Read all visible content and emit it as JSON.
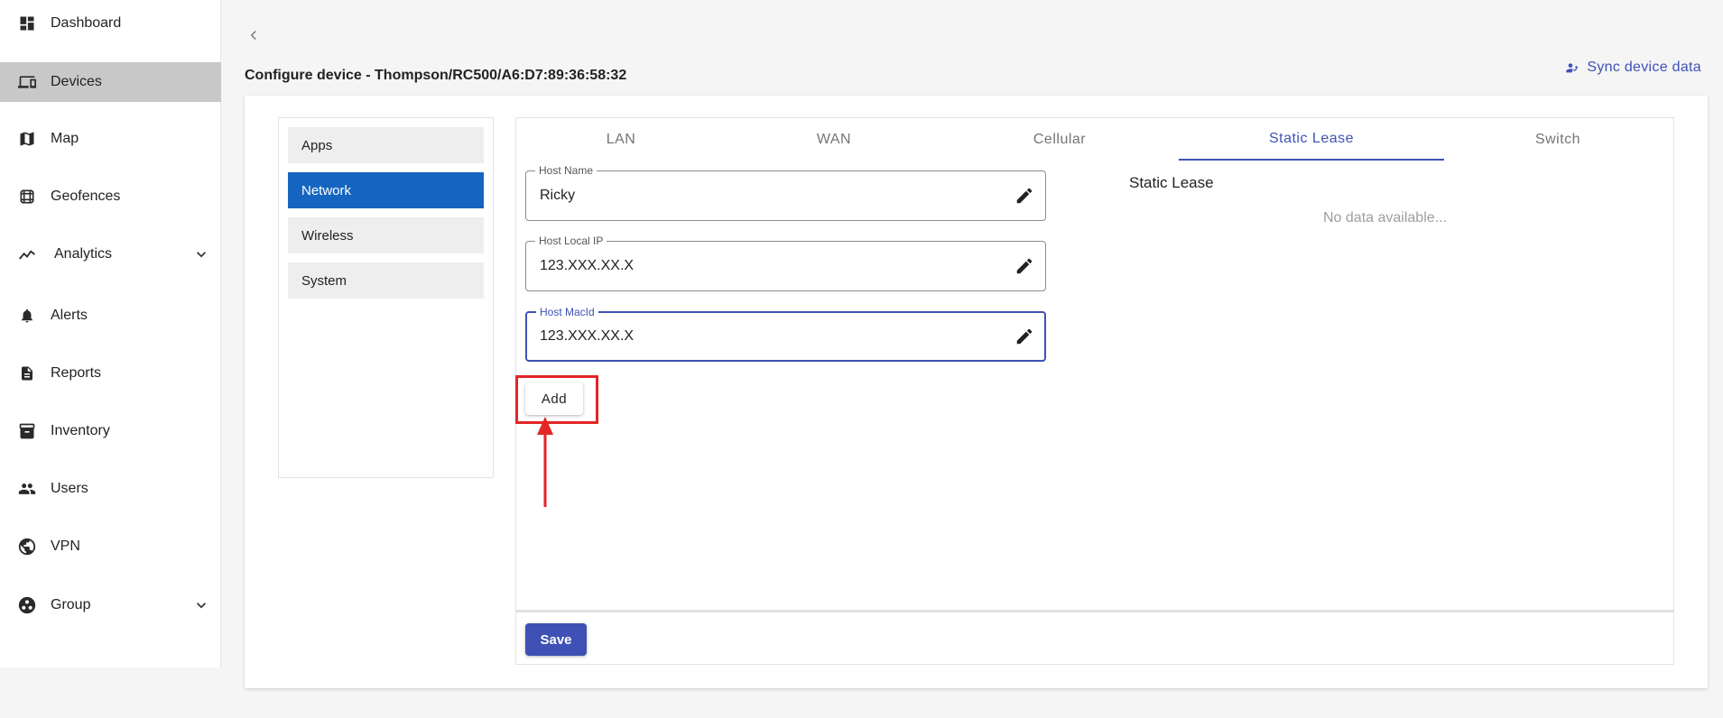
{
  "sidebar": {
    "items": [
      {
        "label": "Dashboard",
        "icon": "dashboard-icon"
      },
      {
        "label": "Devices",
        "icon": "devices-icon",
        "active": true
      },
      {
        "label": "Map",
        "icon": "map-icon"
      },
      {
        "label": "Geofences",
        "icon": "geofence-icon"
      },
      {
        "label": "Analytics",
        "icon": "analytics-icon",
        "expandable": true
      },
      {
        "label": "Alerts",
        "icon": "bell-icon"
      },
      {
        "label": "Reports",
        "icon": "report-icon"
      },
      {
        "label": "Inventory",
        "icon": "inventory-icon"
      },
      {
        "label": "Users",
        "icon": "users-icon"
      },
      {
        "label": "VPN",
        "icon": "vpn-icon"
      },
      {
        "label": "Group",
        "icon": "group-icon",
        "expandable": true
      }
    ]
  },
  "header": {
    "title": "Configure device - Thompson/RC500/A6:D7:89:36:58:32",
    "sync_label": "Sync device data"
  },
  "config_menu": {
    "items": [
      "Apps",
      "Network",
      "Wireless",
      "System"
    ],
    "active": "Network"
  },
  "tabs": {
    "items": [
      "LAN",
      "WAN",
      "Cellular",
      "Static Lease",
      "Switch"
    ],
    "active": "Static Lease"
  },
  "form": {
    "host_name": {
      "label": "Host Name",
      "value": "Ricky"
    },
    "host_local_ip": {
      "label": "Host Local IP",
      "value": "123.XXX.XX.X"
    },
    "host_macid": {
      "label": "Host MacId",
      "value": "123.XXX.XX.X"
    },
    "add_label": "Add"
  },
  "static_lease": {
    "title": "Static Lease",
    "empty_text": "No data available..."
  },
  "footer": {
    "save_label": "Save"
  },
  "colors": {
    "accent": "#3f51b5",
    "menu_active": "#1565c0",
    "annotation": "#e32626"
  }
}
